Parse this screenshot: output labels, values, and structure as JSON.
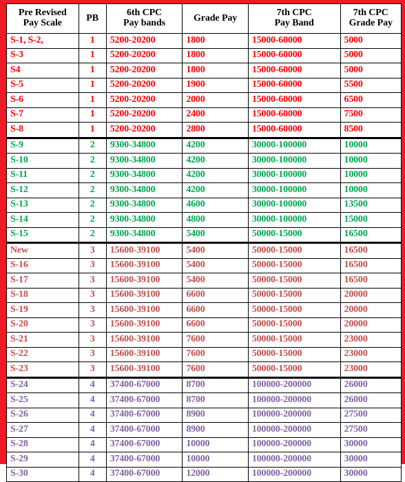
{
  "table": {
    "columns": [
      {
        "id": "pre_revised_pay_scale",
        "line1": "Pre Revised",
        "line2": "Pay Scale"
      },
      {
        "id": "pb",
        "line1": "PB",
        "line2": ""
      },
      {
        "id": "sixth_cpc_pay_bands",
        "line1": "6th CPC",
        "line2": "Pay bands"
      },
      {
        "id": "grade_pay",
        "line1": "Grade Pay",
        "line2": ""
      },
      {
        "id": "seventh_cpc_pay_band",
        "line1": "7th CPC",
        "line2": "Pay Band"
      },
      {
        "id": "seventh_cpc_grade_pay",
        "line1": "7th CPC",
        "line2": "Grade Pay"
      }
    ],
    "colors": {
      "border_frame": "#ee1b24",
      "grid": "#000000",
      "group_pb1": "#fb0007",
      "group_pb2": "#00a94f",
      "group_pb3": "#c0504d",
      "group_pb4": "#8064a2",
      "header_text": "#000000",
      "cell_background": "#ffffff"
    },
    "rows": [
      {
        "group": "red",
        "group_start": false,
        "scale": "S-1, S-2,",
        "pb": "1",
        "band6": "5200-20200",
        "grade6": "1800",
        "band7": "15000-60000",
        "grade7": "5000"
      },
      {
        "group": "red",
        "group_start": false,
        "scale": "S-3",
        "pb": "1",
        "band6": "5200-20200",
        "grade6": "1800",
        "band7": "15000-60000",
        "grade7": "5000"
      },
      {
        "group": "red",
        "group_start": false,
        "scale": "S4",
        "pb": "1",
        "band6": "5200-20200",
        "grade6": "1800",
        "band7": "15000-60000",
        "grade7": "5000"
      },
      {
        "group": "red",
        "group_start": false,
        "scale": "S-5",
        "pb": "1",
        "band6": "5200-20200",
        "grade6": "1900",
        "band7": "15000-60000",
        "grade7": "5500"
      },
      {
        "group": "red",
        "group_start": false,
        "scale": "S-6",
        "pb": "1",
        "band6": "5200-20200",
        "grade6": "2000",
        "band7": "15000-60000",
        "grade7": "6500"
      },
      {
        "group": "red",
        "group_start": false,
        "scale": "S-7",
        "pb": "1",
        "band6": "5200-20200",
        "grade6": "2400",
        "band7": "15000-60000",
        "grade7": "7500"
      },
      {
        "group": "red",
        "group_start": false,
        "scale": "S-8",
        "pb": "1",
        "band6": "5200-20200",
        "grade6": "2800",
        "band7": "15000-60000",
        "grade7": "8500"
      },
      {
        "group": "green",
        "group_start": true,
        "scale": "S-9",
        "pb": "2",
        "band6": "9300-34800",
        "grade6": "4200",
        "band7": "30000-100000",
        "grade7": "10000"
      },
      {
        "group": "green",
        "group_start": false,
        "scale": "S-10",
        "pb": "2",
        "band6": "9300-34800",
        "grade6": "4200",
        "band7": "30000-100000",
        "grade7": "10000"
      },
      {
        "group": "green",
        "group_start": false,
        "scale": "S-11",
        "pb": "2",
        "band6": "9300-34800",
        "grade6": "4200",
        "band7": "30000-100000",
        "grade7": "10000"
      },
      {
        "group": "green",
        "group_start": false,
        "scale": "S-12",
        "pb": "2",
        "band6": "9300-34800",
        "grade6": "4200",
        "band7": "30000-100000",
        "grade7": "10000"
      },
      {
        "group": "green",
        "group_start": false,
        "scale": "S-13",
        "pb": "2",
        "band6": "9300-34800",
        "grade6": "4600",
        "band7": "30000-100000",
        "grade7": "13500"
      },
      {
        "group": "green",
        "group_start": false,
        "scale": "S-14",
        "pb": "2",
        "band6": "9300-34800",
        "grade6": "4800",
        "band7": "30000-100000",
        "grade7": "15000"
      },
      {
        "group": "green",
        "group_start": false,
        "scale": "S-15",
        "pb": "2",
        "band6": "9300-34800",
        "grade6": "5400",
        "band7": "50000-15000",
        "grade7": "16500"
      },
      {
        "group": "brown",
        "group_start": true,
        "scale": "New",
        "pb": "3",
        "band6": "15600-39100",
        "grade6": "5400",
        "band7": "50000-15000",
        "grade7": "16500"
      },
      {
        "group": "brown",
        "group_start": false,
        "scale": "S-16",
        "pb": "3",
        "band6": "15600-39100",
        "grade6": "5400",
        "band7": "50000-15000",
        "grade7": "16500"
      },
      {
        "group": "brown",
        "group_start": false,
        "scale": "S-17",
        "pb": "3",
        "band6": "15600-39100",
        "grade6": "5400",
        "band7": "50000-15000",
        "grade7": "16500"
      },
      {
        "group": "brown",
        "group_start": false,
        "scale": "S-18",
        "pb": "3",
        "band6": "15600-39100",
        "grade6": "6600",
        "band7": "50000-15000",
        "grade7": "20000"
      },
      {
        "group": "brown",
        "group_start": false,
        "scale": "S-19",
        "pb": "3",
        "band6": "15600-39100",
        "grade6": "6600",
        "band7": "50000-15000",
        "grade7": "20000"
      },
      {
        "group": "brown",
        "group_start": false,
        "scale": "S-20",
        "pb": "3",
        "band6": "15600-39100",
        "grade6": "6600",
        "band7": "50000-15000",
        "grade7": "20000"
      },
      {
        "group": "brown",
        "group_start": false,
        "scale": "S-21",
        "pb": "3",
        "band6": "15600-39100",
        "grade6": "7600",
        "band7": "50000-15000",
        "grade7": "23000"
      },
      {
        "group": "brown",
        "group_start": false,
        "scale": "S-22",
        "pb": "3",
        "band6": "15600-39100",
        "grade6": "7600",
        "band7": "50000-15000",
        "grade7": "23000"
      },
      {
        "group": "brown",
        "group_start": false,
        "scale": "S-23",
        "pb": "3",
        "band6": "15600-39100",
        "grade6": "7600",
        "band7": "50000-15000",
        "grade7": "23000"
      },
      {
        "group": "purple",
        "group_start": true,
        "scale": "S-24",
        "pb": "4",
        "band6": "37400-67000",
        "grade6": "8700",
        "band7": "100000-200000",
        "grade7": "26000"
      },
      {
        "group": "purple",
        "group_start": false,
        "scale": "S-25",
        "pb": "4",
        "band6": "37400-67000",
        "grade6": "8700",
        "band7": "100000-200000",
        "grade7": "26000"
      },
      {
        "group": "purple",
        "group_start": false,
        "scale": "S-26",
        "pb": "4",
        "band6": "37400-67000",
        "grade6": "8900",
        "band7": "100000-200000",
        "grade7": "27500"
      },
      {
        "group": "purple",
        "group_start": false,
        "scale": "S-27",
        "pb": "4",
        "band6": "37400-67000",
        "grade6": "8900",
        "band7": "100000-200000",
        "grade7": "27500"
      },
      {
        "group": "purple",
        "group_start": false,
        "scale": "S-28",
        "pb": "4",
        "band6": "37400-67000",
        "grade6": "10000",
        "band7": "100000-200000",
        "grade7": "30000"
      },
      {
        "group": "purple",
        "group_start": false,
        "scale": "S-29",
        "pb": "4",
        "band6": "37400-67000",
        "grade6": "10000",
        "band7": "100000-200000",
        "grade7": "30000"
      },
      {
        "group": "purple",
        "group_start": false,
        "scale": "S-30",
        "pb": "4",
        "band6": "37400-67000",
        "grade6": "12000",
        "band7": "100000-200000",
        "grade7": "30000"
      }
    ]
  }
}
